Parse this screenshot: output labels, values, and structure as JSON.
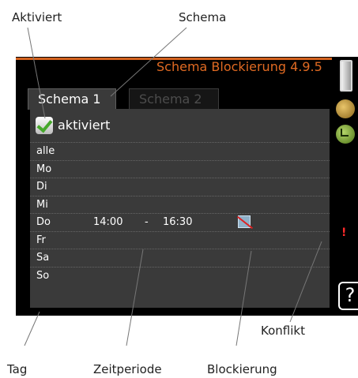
{
  "window": {
    "title": "Schema Blockierung",
    "menu_number": "4.9.5"
  },
  "tabs": [
    {
      "label": "Schema 1",
      "active": true
    },
    {
      "label": "Schema 2",
      "active": false
    }
  ],
  "activation": {
    "label": "aktiviert",
    "checked": true
  },
  "days": [
    {
      "label": "alle"
    },
    {
      "label": "Mo"
    },
    {
      "label": "Di"
    },
    {
      "label": "Mi"
    },
    {
      "label": "Do",
      "start": "14:00",
      "dash": "-",
      "end": "16:30",
      "blocked_icon": "block-icon",
      "conflict": "!"
    },
    {
      "label": "Fr"
    },
    {
      "label": "Sa"
    },
    {
      "label": "So"
    }
  ],
  "callouts": {
    "aktiviert": "Aktiviert",
    "schema": "Schema",
    "konflikt": "Konflikt",
    "tag": "Tag",
    "zeitperiode": "Zeitperiode",
    "blockierung": "Blockierung"
  },
  "help_label": "?",
  "colors": {
    "screen_bg": "#000000",
    "panel_bg": "#3a3a3a",
    "title": "#e06a22",
    "accent_line": "#d4621f",
    "conflict": "#ff2a2a",
    "check": "#46a82b"
  }
}
